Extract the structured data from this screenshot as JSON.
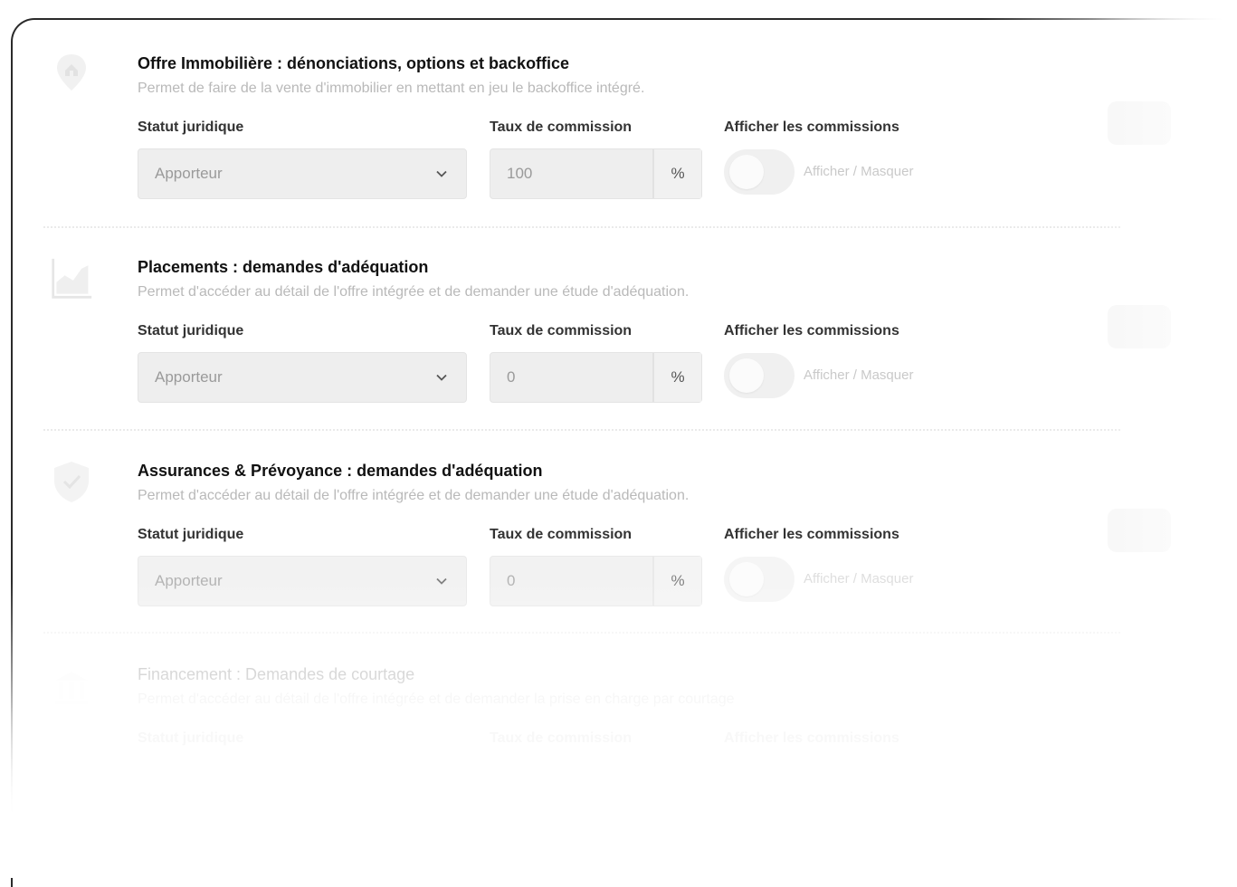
{
  "sections": [
    {
      "icon": "house-pin-icon",
      "title": "Offre Immobilière : dénonciations, options et backoffice",
      "description": "Permet de faire de la vente d'immobilier en mettant en jeu le backoffice intégré.",
      "statut_label": "Statut juridique",
      "statut_value": "Apporteur",
      "taux_label": "Taux de commission",
      "taux_value": "100",
      "taux_unit": "%",
      "afficher_label": "Afficher les commissions",
      "toggle_text": "Afficher / Masquer"
    },
    {
      "icon": "chart-icon",
      "title": "Placements : demandes d'adéquation",
      "description": "Permet d'accéder au détail de l'offre intégrée et de demander une étude d'adéquation.",
      "statut_label": "Statut juridique",
      "statut_value": "Apporteur",
      "taux_label": "Taux de commission",
      "taux_value": "0",
      "taux_unit": "%",
      "afficher_label": "Afficher les commissions",
      "toggle_text": "Afficher / Masquer"
    },
    {
      "icon": "shield-check-icon",
      "title": "Assurances & Prévoyance : demandes d'adéquation",
      "description": "Permet d'accéder au détail de l'offre intégrée et de demander une étude d'adéquation.",
      "statut_label": "Statut juridique",
      "statut_value": "Apporteur",
      "taux_label": "Taux de commission",
      "taux_value": "0",
      "taux_unit": "%",
      "afficher_label": "Afficher les commissions",
      "toggle_text": "Afficher / Masquer"
    },
    {
      "icon": "bank-icon",
      "title": "Financement : Demandes de courtage",
      "description": "Permet d'accéder au détail de l'offre intégrée et de demander la prise en charge par courtage",
      "statut_label": "Statut juridique",
      "taux_label": "Taux de commission",
      "afficher_label": "Afficher les commissions"
    }
  ]
}
